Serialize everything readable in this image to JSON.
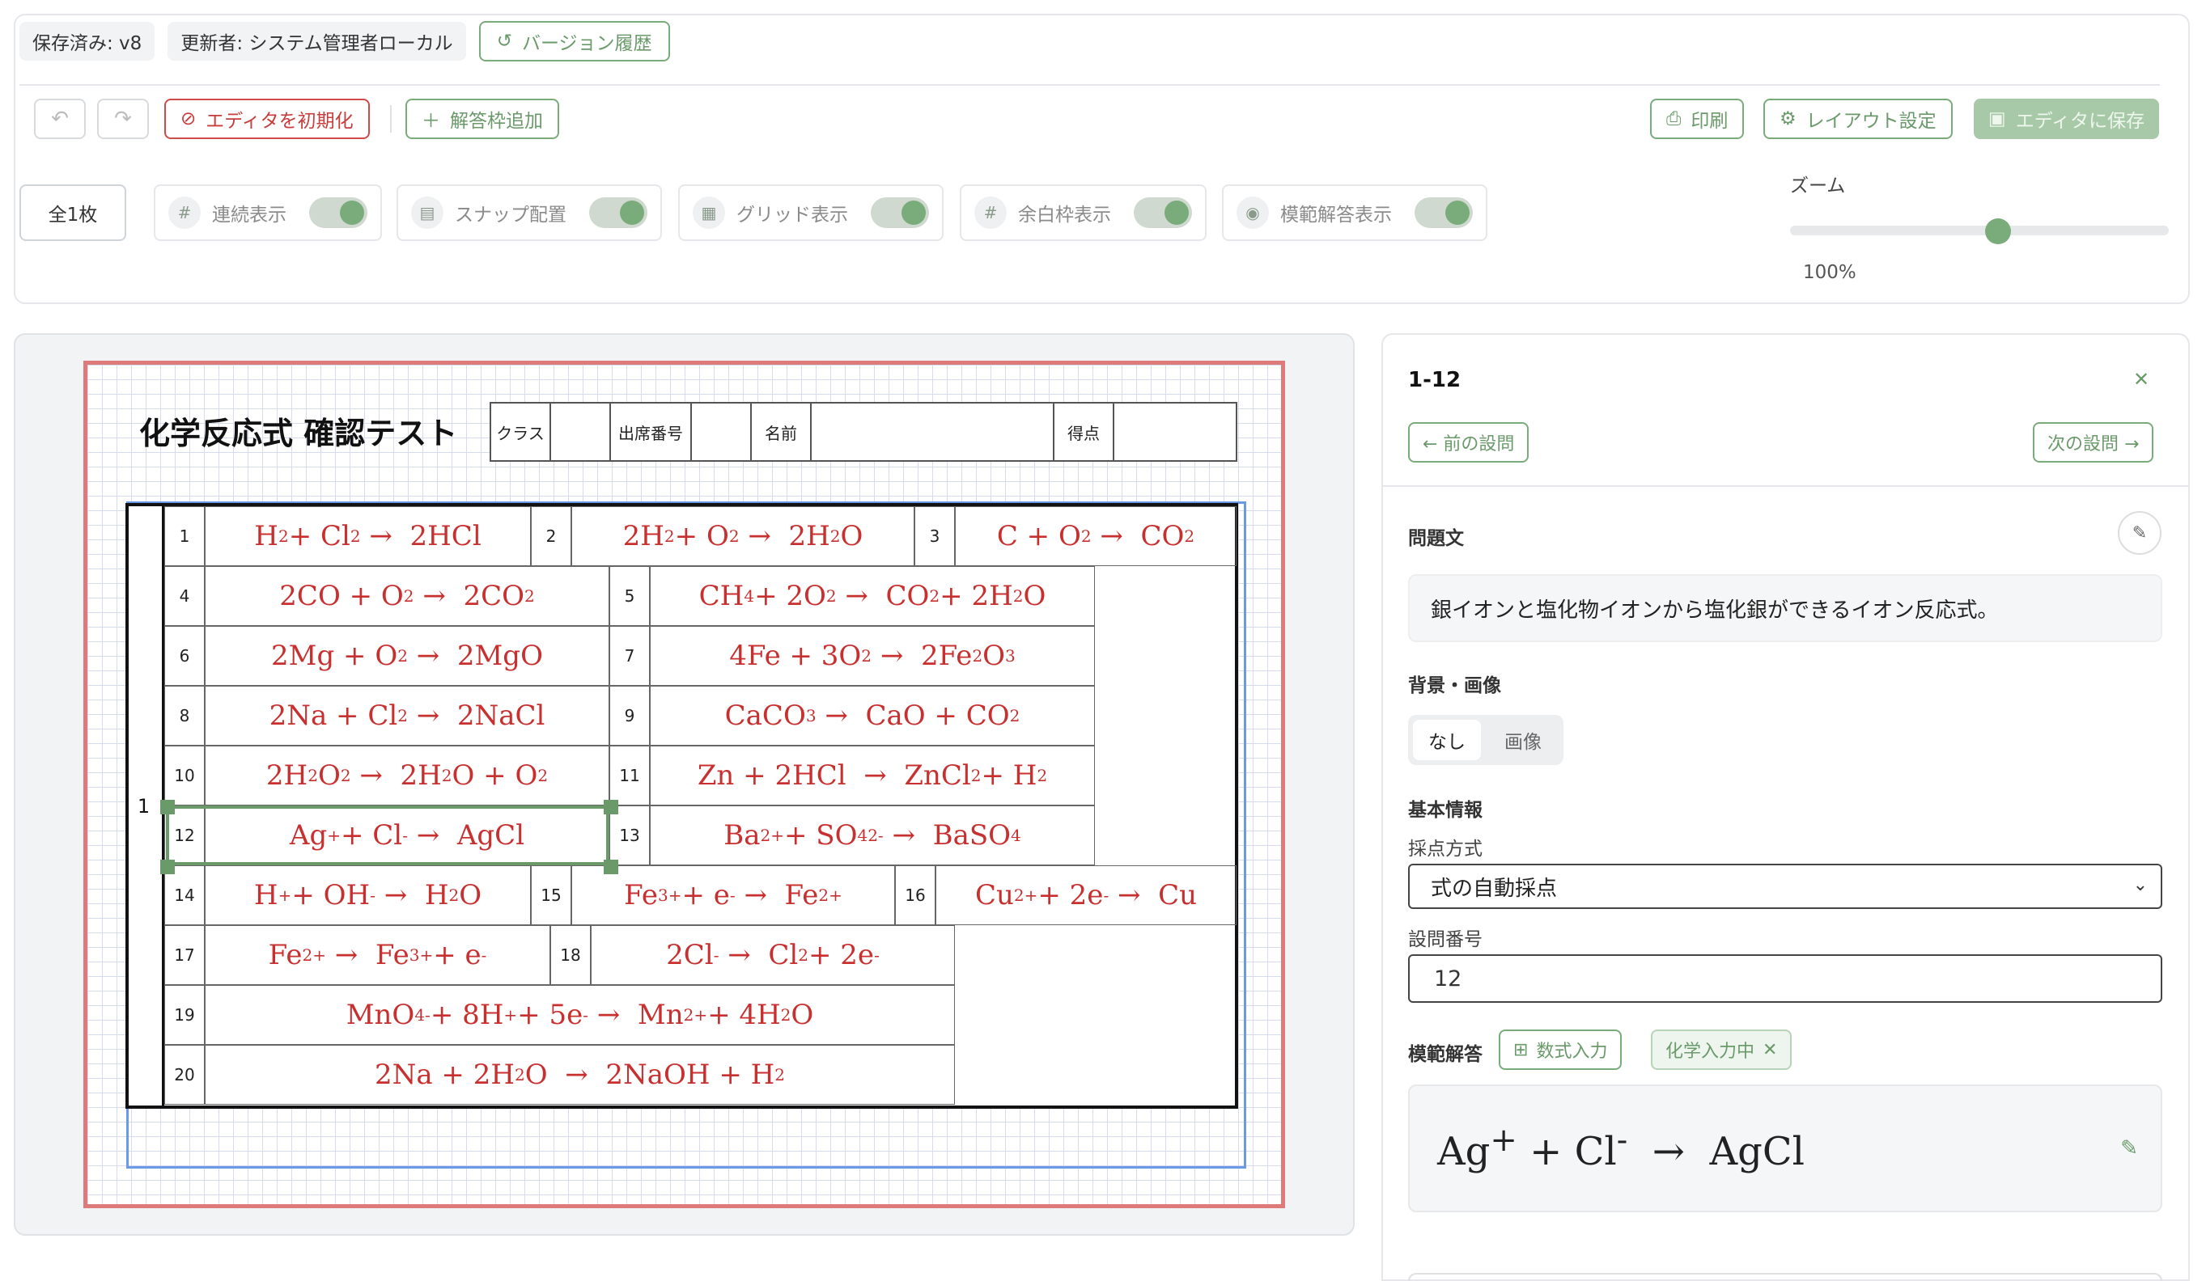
{
  "header": {
    "saved_label": "保存済み: v8",
    "updated_by": "更新者: システム管理者ローカル",
    "version_history": "バージョン履歴"
  },
  "toolbar": {
    "reset_label": "エディタを初期化",
    "add_answer_label": "解答枠追加",
    "print_label": "印刷",
    "layout_label": "レイアウト設定",
    "save_label": "エディタに保存"
  },
  "view": {
    "page_count": "全1枚",
    "toggles": [
      {
        "label": "連続表示",
        "on": true
      },
      {
        "label": "スナップ配置",
        "on": true
      },
      {
        "label": "グリッド表示",
        "on": true
      },
      {
        "label": "余白枠表示",
        "on": true
      },
      {
        "label": "模範解答表示",
        "on": true
      }
    ],
    "zoom_label": "ズーム",
    "zoom_value": "100%",
    "zoom_fraction": 0.55
  },
  "exam": {
    "title": "化学反応式 確認テスト",
    "info_fields": [
      "クラス",
      "出席番号",
      "名前",
      "得点"
    ],
    "group_number": "1"
  },
  "questions": [
    {
      "n": "1",
      "eq": "H<sub>2</sub> + Cl<sub>2</sub> &nbsp;→&nbsp; 2HCl"
    },
    {
      "n": "2",
      "eq": "2H<sub>2</sub> + O<sub>2</sub> &nbsp;→&nbsp; 2H<sub>2</sub>O"
    },
    {
      "n": "3",
      "eq": "C + O<sub>2</sub> &nbsp;→&nbsp; CO<sub>2</sub>"
    },
    {
      "n": "4",
      "eq": "2CO + O<sub>2</sub> &nbsp;→&nbsp; 2CO<sub>2</sub>"
    },
    {
      "n": "5",
      "eq": "CH<sub>4</sub> + 2O<sub>2</sub> &nbsp;→&nbsp; CO<sub>2</sub> + 2H<sub>2</sub>O"
    },
    {
      "n": "6",
      "eq": "2Mg + O<sub>2</sub> &nbsp;→&nbsp; 2MgO"
    },
    {
      "n": "7",
      "eq": "4Fe + 3O<sub>2</sub> &nbsp;→&nbsp; 2Fe<sub>2</sub>O<sub>3</sub>"
    },
    {
      "n": "8",
      "eq": "2Na + Cl<sub>2</sub> &nbsp;→&nbsp; 2NaCl"
    },
    {
      "n": "9",
      "eq": "CaCO<sub>3</sub> &nbsp;→&nbsp; CaO + CO<sub>2</sub>"
    },
    {
      "n": "10",
      "eq": "2H<sub>2</sub>O<sub>2</sub> &nbsp;→&nbsp; 2H<sub>2</sub>O + O<sub>2</sub>"
    },
    {
      "n": "11",
      "eq": "Zn + 2HCl &nbsp;→&nbsp; ZnCl<sub>2</sub> + H<sub>2</sub>"
    },
    {
      "n": "12",
      "eq": "Ag<sup>+</sup> + Cl<sup>-</sup> &nbsp;→&nbsp; AgCl"
    },
    {
      "n": "13",
      "eq": "Ba<sup>2+</sup> + SO<sub>4</sub><sup>2-</sup> &nbsp;→&nbsp; BaSO<sub>4</sub>"
    },
    {
      "n": "14",
      "eq": "H<sup>+</sup> + OH<sup>-</sup> &nbsp;→&nbsp; H<sub>2</sub>O"
    },
    {
      "n": "15",
      "eq": "Fe<sup>3+</sup> + e<sup>-</sup> &nbsp;→&nbsp; Fe<sup>2+</sup>"
    },
    {
      "n": "16",
      "eq": "Cu<sup>2+</sup> + 2e<sup>-</sup> &nbsp;→&nbsp; Cu"
    },
    {
      "n": "17",
      "eq": "Fe<sup>2+</sup> &nbsp;→&nbsp; Fe<sup>3+</sup> + e<sup>-</sup>"
    },
    {
      "n": "18",
      "eq": "2Cl<sup>-</sup> &nbsp;→&nbsp; Cl<sub>2</sub> + 2e<sup>-</sup>"
    },
    {
      "n": "19",
      "eq": "MnO<sub>4</sub><sup>-</sup> + 8H<sup>+</sup> + 5e<sup>-</sup> &nbsp;→&nbsp; Mn<sup>2+</sup> + 4H<sub>2</sub>O"
    },
    {
      "n": "20",
      "eq": "2Na + 2H<sub>2</sub>O &nbsp;→&nbsp; 2NaOH + H<sub>2</sub>"
    }
  ],
  "panel": {
    "title": "1-12",
    "prev": "← 前の設問",
    "next": "次の設問 →",
    "question_text_label": "問題文",
    "question_text": "銀イオンと塩化物イオンから塩化銀ができるイオン反応式。",
    "background_label": "背景・画像",
    "bg_none": "なし",
    "bg_image": "画像",
    "basic_info_label": "基本情報",
    "scoring_label": "採点方式",
    "scoring_value": "式の自動採点",
    "number_label": "設問番号",
    "number_value": "12",
    "model_answer_label": "模範解答",
    "formula_input": "数式入力",
    "chem_input": "化学入力中",
    "model_answer_eq": "Ag<sup>+</sup> + Cl<sup>-</sup> &nbsp;→&nbsp; AgCl"
  },
  "colors": {
    "accent": "#7aab7a",
    "danger": "#c83c3c",
    "equation": "#c83030",
    "paper_border": "#de7a7a",
    "margin_box": "#6a9ae6"
  }
}
